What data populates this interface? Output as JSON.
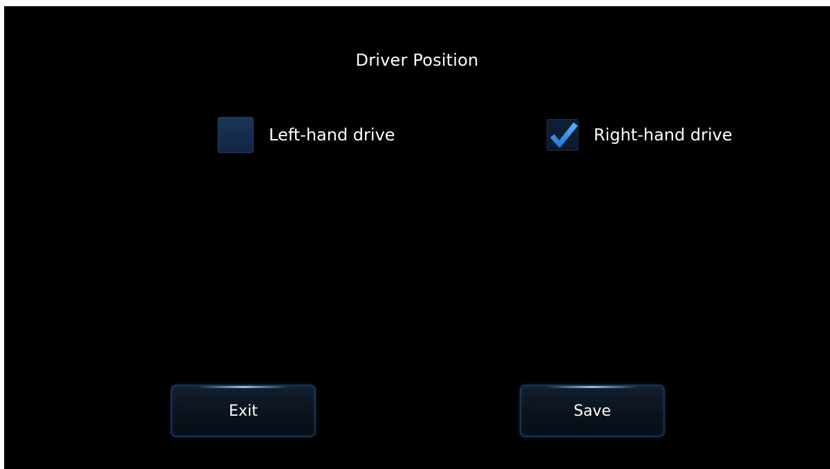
{
  "screen": {
    "title": "Driver Position"
  },
  "options": [
    {
      "label": "Left-hand drive",
      "checked": false
    },
    {
      "label": "Right-hand drive",
      "checked": true
    }
  ],
  "buttons": {
    "exit_label": "Exit",
    "save_label": "Save"
  },
  "colors": {
    "background": "#000000",
    "checkbox_fill": "#1b3658",
    "checkmark": "#2f8ee6",
    "button_border": "#1a3552"
  },
  "icons": {
    "checkmark": "checkmark-icon"
  }
}
